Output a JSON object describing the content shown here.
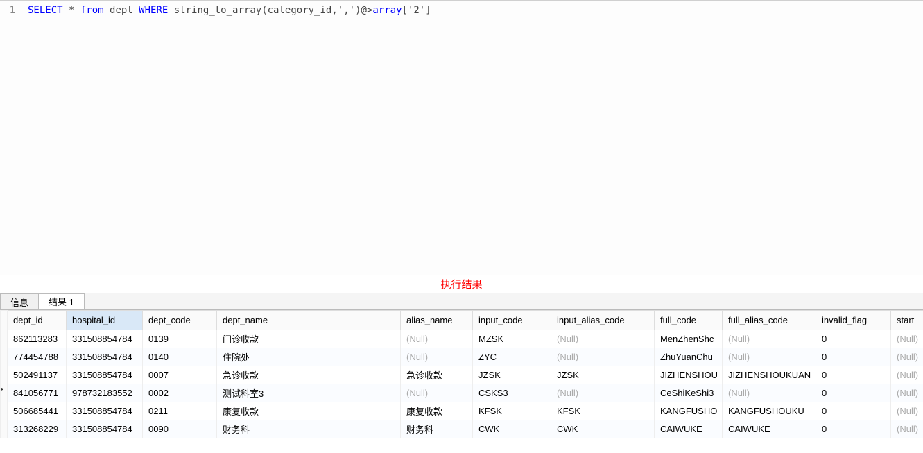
{
  "editor": {
    "line_number": "1",
    "sql_select": "SELECT",
    "sql_star": " * ",
    "sql_from": "from",
    "sql_table": " dept ",
    "sql_where": "WHERE",
    "sql_func": " string_to_array(category_id,",
    "sql_str1": "','",
    "sql_op": ")@>",
    "sql_array": "array",
    "sql_br1": "[",
    "sql_str2": "'2'",
    "sql_br2": "]"
  },
  "result_label": "执行结果",
  "tabs": {
    "info": "信息",
    "result": "结果 1"
  },
  "columns": {
    "dept_id": "dept_id",
    "hospital_id": "hospital_id",
    "dept_code": "dept_code",
    "dept_name": "dept_name",
    "alias_name": "alias_name",
    "input_code": "input_code",
    "input_alias_code": "input_alias_code",
    "full_code": "full_code",
    "full_alias_code": "full_alias_code",
    "invalid_flag": "invalid_flag",
    "start": "start"
  },
  "null_text": "(Null)",
  "rows": [
    {
      "dept_id": "862113283",
      "hospital_id": "331508854784",
      "dept_code": "0139",
      "dept_name": "门诊收款",
      "alias_name": null,
      "input_code": "MZSK",
      "input_alias_code": null,
      "full_code": "MenZhenShc",
      "full_alias_code": null,
      "invalid_flag": "0",
      "start": null,
      "active": false
    },
    {
      "dept_id": "774454788",
      "hospital_id": "331508854784",
      "dept_code": "0140",
      "dept_name": "住院处",
      "alias_name": null,
      "input_code": "ZYC",
      "input_alias_code": null,
      "full_code": "ZhuYuanChu",
      "full_alias_code": null,
      "invalid_flag": "0",
      "start": null,
      "active": false
    },
    {
      "dept_id": "502491137",
      "hospital_id": "331508854784",
      "dept_code": "0007",
      "dept_name": "急诊收款",
      "alias_name": "急诊收款",
      "input_code": "JZSK",
      "input_alias_code": "JZSK",
      "full_code": "JIZHENSHOU",
      "full_alias_code": "JIZHENSHOUKUAN",
      "invalid_flag": "0",
      "start": null,
      "active": false
    },
    {
      "dept_id": "841056771",
      "hospital_id": "978732183552",
      "dept_code": "0002",
      "dept_name": "测试科室3",
      "alias_name": null,
      "input_code": "CSKS3",
      "input_alias_code": null,
      "full_code": "CeShiKeShi3",
      "full_alias_code": null,
      "invalid_flag": "0",
      "start": null,
      "active": true
    },
    {
      "dept_id": "506685441",
      "hospital_id": "331508854784",
      "dept_code": "0211",
      "dept_name": "康复收款",
      "alias_name": "康复收款",
      "input_code": "KFSK",
      "input_alias_code": "KFSK",
      "full_code": "KANGFUSHO",
      "full_alias_code": "KANGFUSHOUKU",
      "invalid_flag": "0",
      "start": null,
      "active": false
    },
    {
      "dept_id": "313268229",
      "hospital_id": "331508854784",
      "dept_code": "0090",
      "dept_name": "财务科",
      "alias_name": "财务科",
      "input_code": "CWK",
      "input_alias_code": "CWK",
      "full_code": "CAIWUKE",
      "full_alias_code": "CAIWUKE",
      "invalid_flag": "0",
      "start": null,
      "active": false
    }
  ]
}
